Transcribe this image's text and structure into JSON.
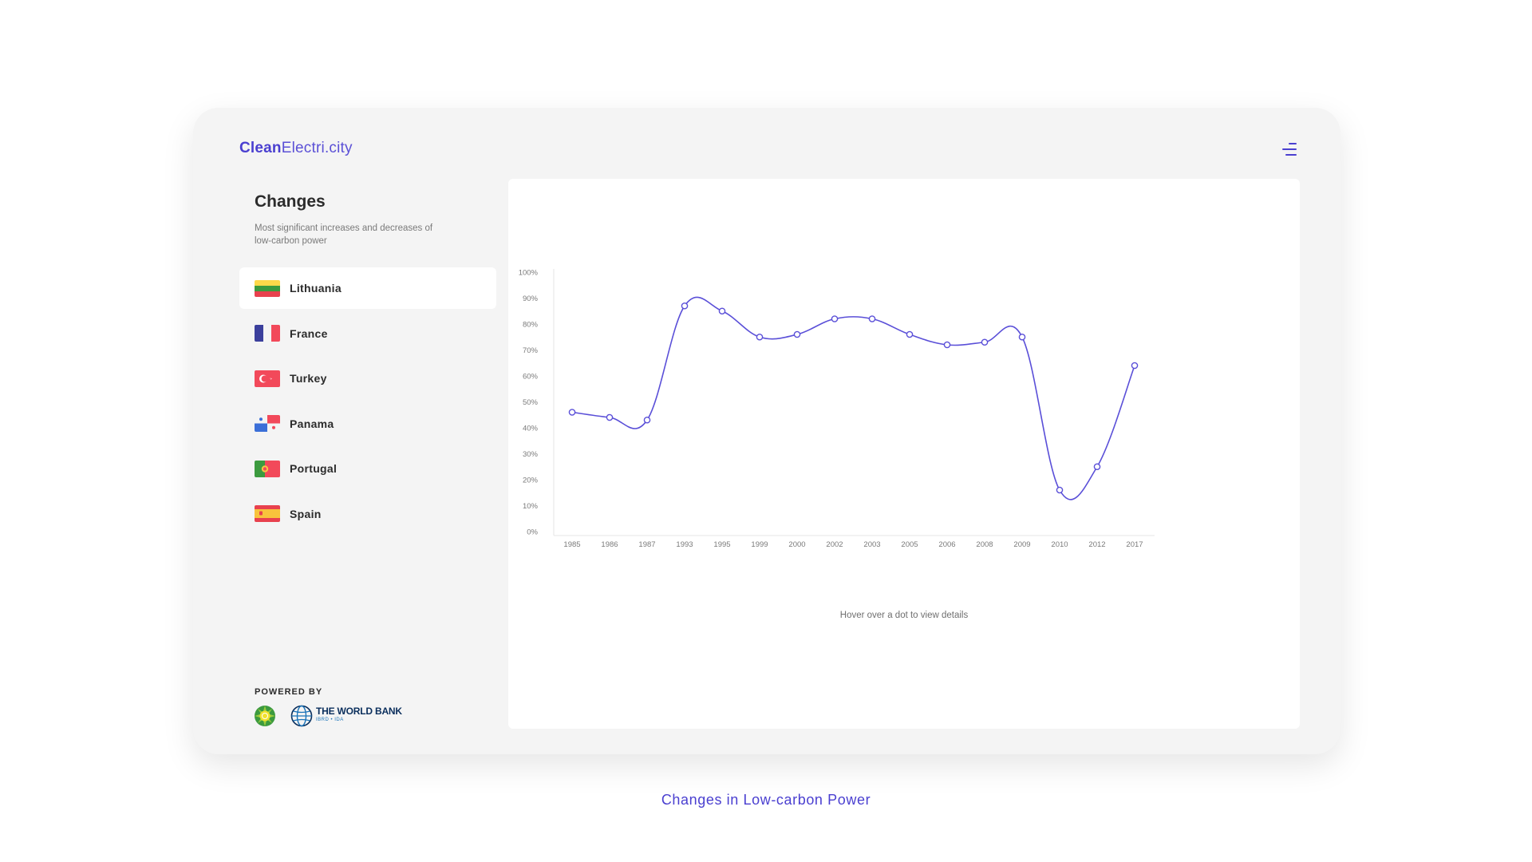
{
  "brand": {
    "bold": "Clean",
    "rest": "Electri.city"
  },
  "menu_icon": "hamburger-menu-icon",
  "sidebar": {
    "title": "Changes",
    "description": "Most significant increases and decreases of low-carbon power",
    "countries": [
      {
        "name": "Lithuania",
        "icon": "lithuania-flag-icon",
        "active": true
      },
      {
        "name": "France",
        "icon": "france-flag-icon",
        "active": false
      },
      {
        "name": "Turkey",
        "icon": "turkey-flag-icon",
        "active": false
      },
      {
        "name": "Panama",
        "icon": "panama-flag-icon",
        "active": false
      },
      {
        "name": "Portugal",
        "icon": "portugal-flag-icon",
        "active": false
      },
      {
        "name": "Spain",
        "icon": "spain-flag-icon",
        "active": false
      }
    ],
    "powered_by": "POWERED BY",
    "partners": {
      "bp_icon": "bp-helios-logo",
      "worldbank_name": "THE WORLD BANK",
      "worldbank_sub": "IBRD • IDA"
    }
  },
  "chart": {
    "hint": "Hover over a dot to view details"
  },
  "caption": "Changes in Low-carbon Power",
  "colors": {
    "accent": "#4a3fd0",
    "line": "#5a4fd8",
    "card_bg": "#f4f4f4"
  },
  "chart_data": {
    "type": "line",
    "title": "",
    "xlabel": "",
    "ylabel": "",
    "categories": [
      "1985",
      "1986",
      "1987",
      "1993",
      "1995",
      "1999",
      "2000",
      "2002",
      "2003",
      "2005",
      "2006",
      "2008",
      "2009",
      "2010",
      "2012",
      "2017"
    ],
    "series": [
      {
        "values": [
          46,
          44,
          43,
          87,
          85,
          75,
          76,
          82,
          82,
          76,
          72,
          73,
          75,
          16,
          25,
          64
        ]
      }
    ],
    "ylim": [
      0,
      100
    ],
    "yticks": [
      "0%",
      "10%",
      "20%",
      "30%",
      "40%",
      "50%",
      "60%",
      "70%",
      "80%",
      "90%",
      "100%"
    ],
    "grid": false,
    "legend": "none"
  }
}
